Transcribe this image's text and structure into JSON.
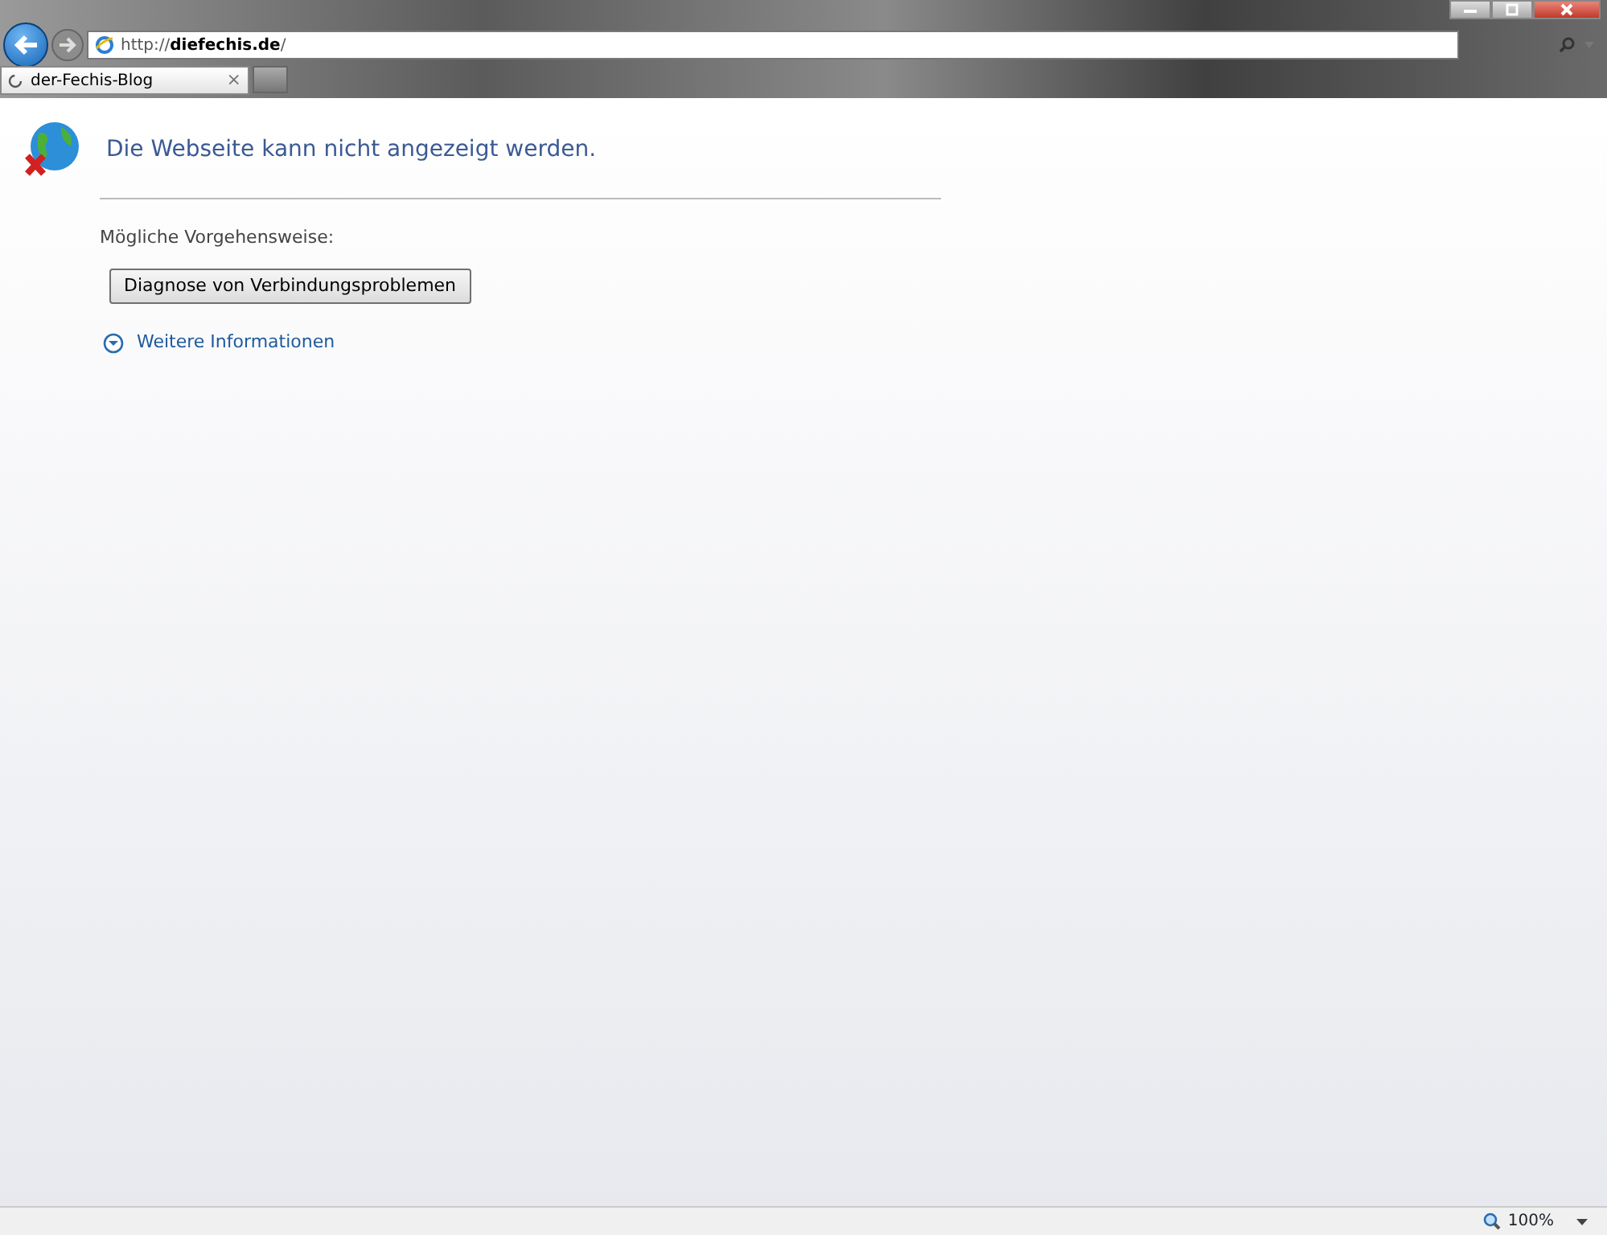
{
  "address_bar": {
    "url": "http://**diefechis.de**/"
  },
  "tabs": [
    {
      "title": "der-Fechis-Blog",
      "close": "×",
      "selected": true,
      "loading": true
    }
  ],
  "error_page": {
    "title": "Die Webseite kann nicht angezeigt werden.",
    "subtitle": "Mögliche Vorgehensweise:",
    "button": "Diagnose von Verbindungsproblemen",
    "more_info": {
      "label": "Weitere Informationen",
      "expanded": false
    }
  },
  "status_bar": {
    "zoom": "100%"
  }
}
